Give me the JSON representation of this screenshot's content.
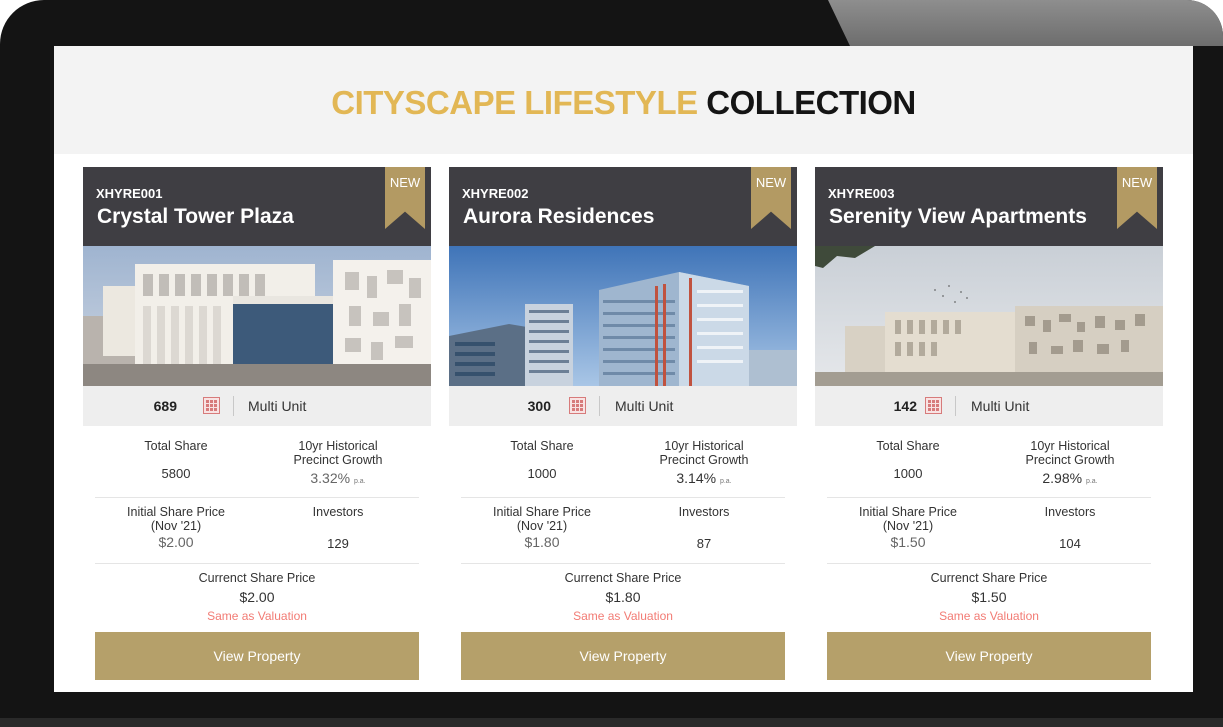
{
  "page": {
    "title_accent": "CITYSCAPE LIFESTYLE",
    "title_rest": "COLLECTION"
  },
  "colors": {
    "accent": "#e2b755",
    "card_header": "#3f3e43",
    "button": "#b5a06a",
    "note": "#f27b74"
  },
  "labels": {
    "total_share": "Total Share",
    "growth_l1": "10yr Historical",
    "growth_l2": "Precinct Growth",
    "pa": "p.a.",
    "initial_l1": "Initial Share Price",
    "initial_l2": "(Nov '21)",
    "investors": "Investors",
    "current": "Currenct Share Price",
    "view_button": "View Property",
    "badge": "NEW"
  },
  "properties": [
    {
      "code": "XHYRE001",
      "name": "Crystal Tower Plaza",
      "units": "689",
      "unit_type": "Multi Unit",
      "total_share": "5800",
      "growth": "3.32%",
      "initial_price": "$2.00",
      "investors": "129",
      "current_price": "$2.00",
      "note": "Same as Valuation",
      "unit_icon": "building-grid-icon"
    },
    {
      "code": "XHYRE002",
      "name": "Aurora Residences",
      "units": "300",
      "unit_type": "Multi Unit",
      "total_share": "1000",
      "growth": "3.14%",
      "initial_price": "$1.80",
      "investors": "87",
      "current_price": "$1.80",
      "note": "Same as Valuation",
      "unit_icon": "building-grid-icon"
    },
    {
      "code": "XHYRE003",
      "name": "Serenity View Apartments",
      "units": "142",
      "unit_type": "Multi Unit",
      "total_share": "1000",
      "growth": "2.98%",
      "initial_price": "$1.50",
      "investors": "104",
      "current_price": "$1.50",
      "note": "Same as Valuation",
      "unit_icon": "building-grid-icon"
    }
  ]
}
